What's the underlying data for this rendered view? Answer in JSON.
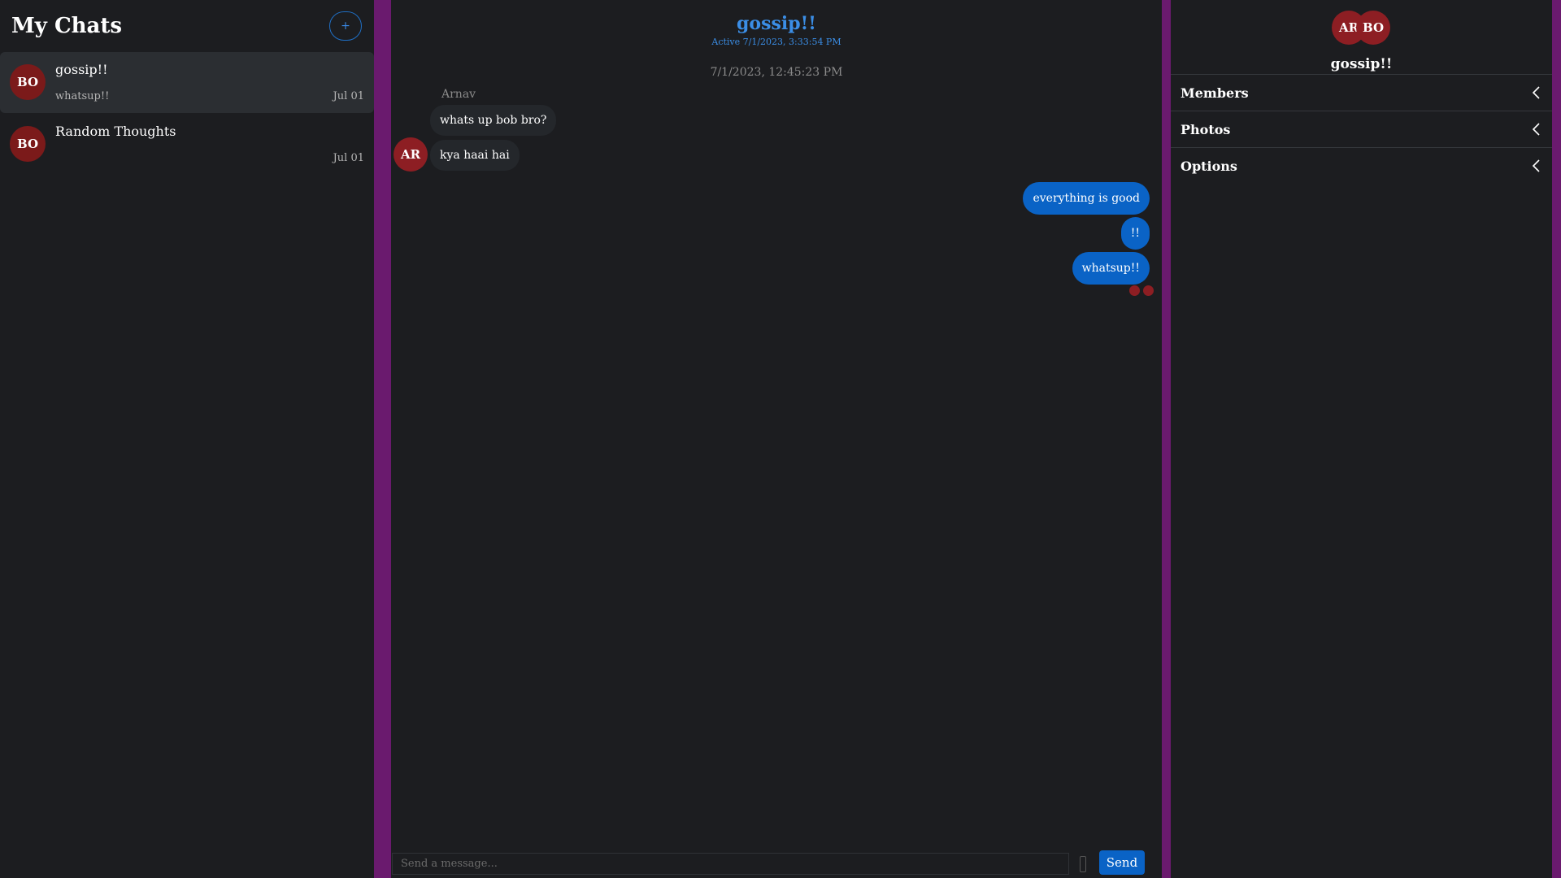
{
  "sidebar": {
    "title": "My Chats",
    "new_chat_label": "+",
    "chats": [
      {
        "avatar": "BO",
        "name": "gossip!!",
        "preview": "whatsup!!",
        "date": "Jul 01"
      },
      {
        "avatar": "BO",
        "name": "Random Thoughts",
        "preview": "",
        "date": "Jul 01"
      }
    ]
  },
  "conversation": {
    "title": "gossip!!",
    "status": "Active 7/1/2023, 3:33:54 PM",
    "timestamp": "7/1/2023, 12:45:23 PM",
    "incoming": {
      "sender": "Arnav",
      "avatar": "AR",
      "messages": [
        "whats up bob bro?",
        "kya haai hai"
      ]
    },
    "outgoing": [
      "everything is good",
      "!!",
      "whatsup!!"
    ]
  },
  "composer": {
    "placeholder": "Send a message...",
    "send_label": "Send"
  },
  "details": {
    "avatars": [
      "AR",
      "BO"
    ],
    "name": "gossip!!",
    "sections": [
      "Members",
      "Photos",
      "Options"
    ]
  },
  "colors": {
    "accent": "#0a63c6",
    "title_blue": "#3b8ee6",
    "divider_purple": "#6a1a6e",
    "avatar_red": "#8d1e23",
    "background": "#1c1d20"
  }
}
